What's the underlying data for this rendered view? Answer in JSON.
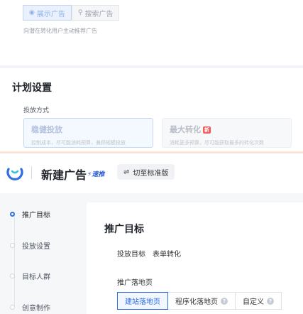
{
  "ad_type": {
    "options": [
      {
        "label": "展示广告",
        "icon": "map-pin-icon",
        "active": true
      },
      {
        "label": "搜索广告",
        "icon": "search-icon",
        "active": false
      }
    ],
    "hint": "向潜在转化用户主动推荐广告"
  },
  "plan_settings": {
    "title": "计划设置",
    "delivery_label": "投放方式",
    "options": [
      {
        "title": "稳健投放",
        "desc": "控制成本，尽可能消耗预算，兼顾规模投放",
        "active": true
      },
      {
        "title": "最大转化",
        "badge": "新",
        "desc": "消耗更多预算，尽可能获取最多的转化次数",
        "active": false
      }
    ]
  },
  "header": {
    "title": "新建广告",
    "speed_badge": "速推",
    "switch_label": "切至标准版",
    "switch_icon": "swap-icon"
  },
  "steps": [
    {
      "label": "推广目标",
      "active": true
    },
    {
      "label": "投放设置",
      "active": false
    },
    {
      "label": "目标人群",
      "active": false
    },
    {
      "label": "创意制作",
      "active": false
    }
  ],
  "main": {
    "title": "推广目标",
    "target_label": "投放目标",
    "target_value": "表单转化",
    "landing_label": "推广落地页",
    "landing_tabs": [
      {
        "label": "建站落地页",
        "active": true,
        "help": false
      },
      {
        "label": "程序化落地页",
        "active": false,
        "help": true
      },
      {
        "label": "自定义",
        "active": false,
        "help": true
      }
    ],
    "help_symbol": "?"
  },
  "colors": {
    "accent": "#2f6fe4",
    "badge": "#f25b5b"
  }
}
